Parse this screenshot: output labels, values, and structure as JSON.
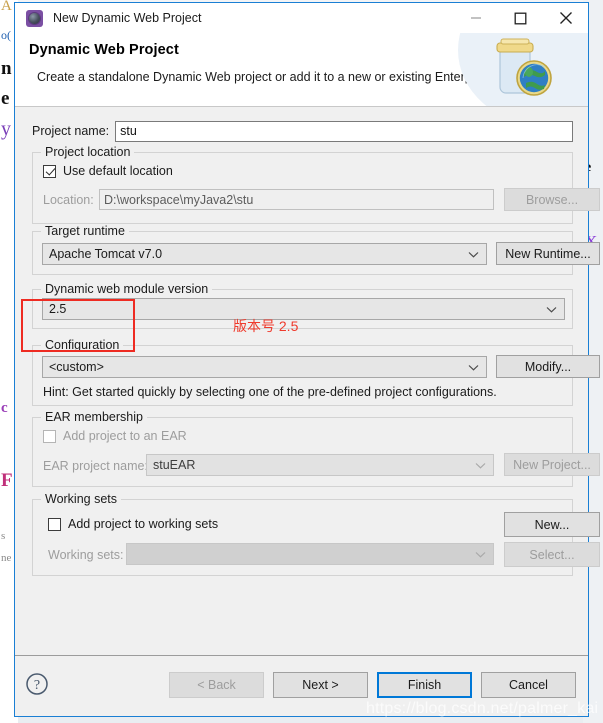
{
  "window": {
    "title": "New Dynamic Web Project",
    "icon": "eclipse-wizard-icon",
    "minimize_label": "minimize-icon",
    "maximize_label": "maximize-icon",
    "close_label": "close-icon"
  },
  "header": {
    "title": "Dynamic Web Project",
    "subtitle": "Create a standalone Dynamic Web project or add it to a new or existing Enterprise Application.",
    "banner_icon": "jar-globe-icon"
  },
  "form": {
    "project_name_label": "Project name:",
    "project_name_value": "stu",
    "project_name_placeholder": ""
  },
  "project_location": {
    "legend": "Project location",
    "use_default_label": "Use default location",
    "use_default_checked": true,
    "location_label": "Location:",
    "location_value": "D:\\workspace\\myJava2\\stu",
    "browse_label": "Browse..."
  },
  "target_runtime": {
    "legend": "Target runtime",
    "selected": "Apache Tomcat v7.0",
    "new_runtime_label": "New Runtime..."
  },
  "web_module": {
    "legend": "Dynamic web module version",
    "selected": "2.5"
  },
  "configuration": {
    "legend": "Configuration",
    "selected": "<custom>",
    "modify_label": "Modify...",
    "hint": "Hint: Get started quickly by selecting one of the pre-defined project configurations."
  },
  "ear_membership": {
    "legend": "EAR membership",
    "add_to_ear_label": "Add project to an EAR",
    "add_to_ear_checked": false,
    "ear_project_name_label": "EAR project name:",
    "ear_project_name_value": "stuEAR",
    "new_project_label": "New Project..."
  },
  "working_sets": {
    "legend": "Working sets",
    "add_to_working_sets_label": "Add project to working sets",
    "add_to_working_sets_checked": false,
    "working_sets_label": "Working sets:",
    "working_sets_value": "",
    "new_label": "New...",
    "select_label": "Select..."
  },
  "footer": {
    "help_icon": "help-question-icon",
    "back_label": "< Back",
    "next_label": "Next >",
    "finish_label": "Finish",
    "cancel_label": "Cancel"
  },
  "annotation": {
    "text": "版本号 2.5",
    "color": "#ef3a2c"
  },
  "watermark": {
    "text": "https://blog.csdn.net/palmer_kai"
  },
  "colors": {
    "accent": "#0078d7",
    "dialog_border": "#1a7fd4",
    "panel": "#f0f0f0",
    "annotation_red": "#ee2b22"
  }
}
